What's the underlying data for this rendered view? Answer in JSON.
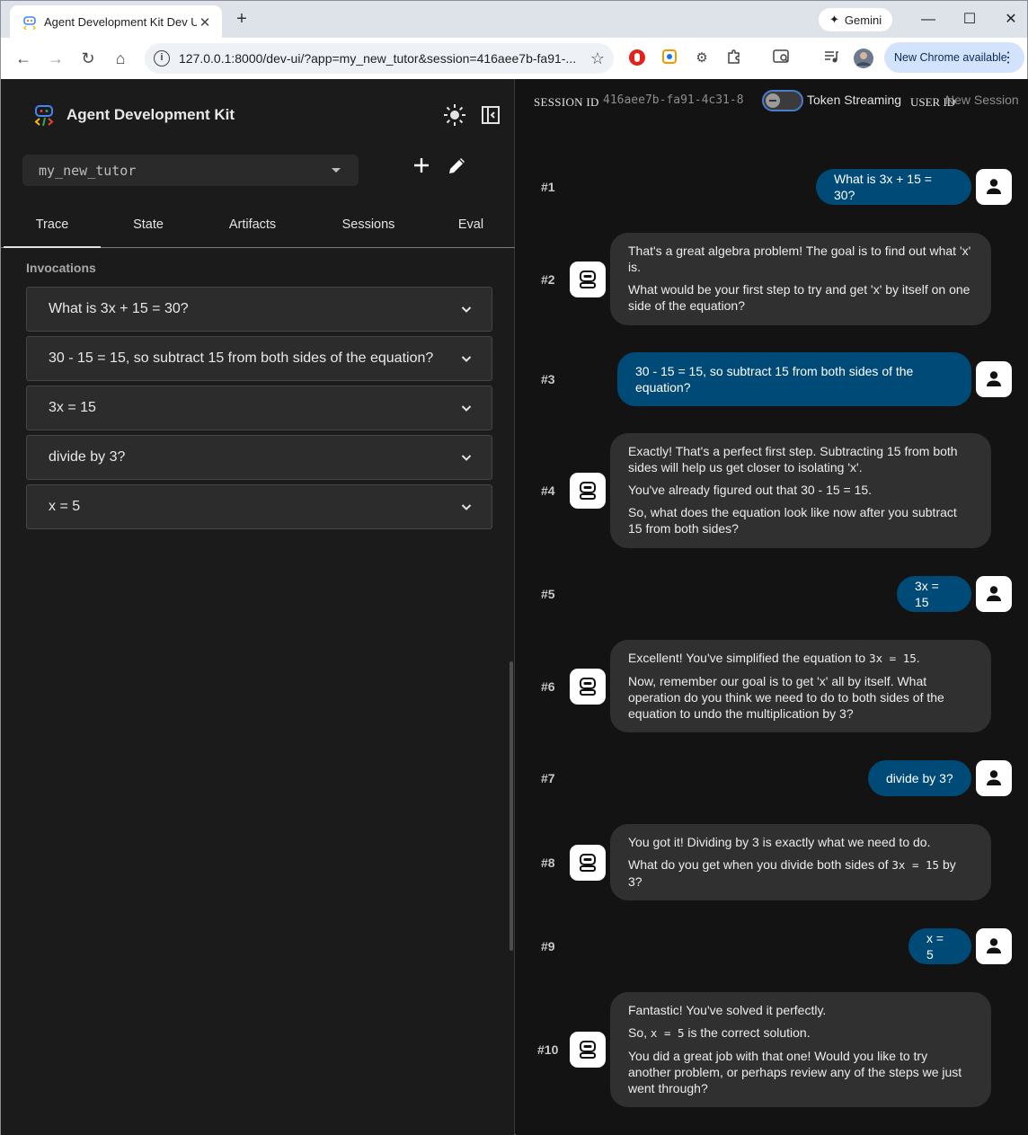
{
  "browser": {
    "tab_title": "Agent Development Kit Dev UI",
    "url": "127.0.0.1:8000/dev-ui/?app=my_new_tutor&session=416aee7b-fa91-...",
    "gemini_label": "Gemini",
    "update_label": "New Chrome available"
  },
  "sidebar": {
    "title": "Agent Development Kit",
    "app_select_value": "my_new_tutor",
    "tabs": [
      "Trace",
      "State",
      "Artifacts",
      "Sessions",
      "Eval"
    ],
    "invocations_label": "Invocations",
    "invocations": [
      "What is 3x + 15 = 30?",
      "30 - 15 = 15, so subtract 15 from both sides of the equation?",
      "3x = 15",
      "divide by 3?",
      "x = 5"
    ]
  },
  "header": {
    "session_label": "SESSION ID",
    "session_id": "416aee7b-fa91-4c31-8",
    "streaming_label": "Token Streaming",
    "user_id_label": "USER ID",
    "new_session_label": "New Session"
  },
  "messages": [
    {
      "index": "#1",
      "role": "user",
      "text": "What is 3x + 15 = 30?"
    },
    {
      "index": "#2",
      "role": "bot",
      "p1": "That's a great algebra problem! The goal is to find out what 'x' is.",
      "p2": "What would be your first step to try and get 'x' by itself on one side of the equation?"
    },
    {
      "index": "#3",
      "role": "user",
      "text": "30 - 15 = 15, so subtract 15 from both sides of the equation?"
    },
    {
      "index": "#4",
      "role": "bot",
      "p1": "Exactly! That's a perfect first step. Subtracting 15 from both sides will help us get closer to isolating 'x'.",
      "p2": "You've already figured out that 30 - 15 = 15.",
      "p3": "So, what does the equation look like now after you subtract 15 from both sides?"
    },
    {
      "index": "#5",
      "role": "user",
      "text": "3x = 15"
    },
    {
      "index": "#6",
      "role": "bot",
      "p1a": "Excellent! You've simplified the equation to ",
      "p1code": "3x = 15",
      "p1b": ".",
      "p2": "Now, remember our goal is to get 'x' all by itself. What operation do you think we need to do to both sides of the equation to undo the multiplication by 3?"
    },
    {
      "index": "#7",
      "role": "user",
      "text": "divide by 3?"
    },
    {
      "index": "#8",
      "role": "bot",
      "p1": "You got it! Dividing by 3 is exactly what we need to do.",
      "p2a": "What do you get when you divide both sides of ",
      "p2code": "3x = 15",
      "p2b": " by 3?"
    },
    {
      "index": "#9",
      "role": "user",
      "text": "x = 5"
    },
    {
      "index": "#10",
      "role": "bot",
      "p1": "Fantastic! You've solved it perfectly.",
      "p2a": "So, ",
      "p2code": "x = 5",
      "p2b": " is the correct solution.",
      "p3": "You did a great job with that one! Would you like to try another problem, or perhaps review any of the steps we just went through?"
    }
  ]
}
